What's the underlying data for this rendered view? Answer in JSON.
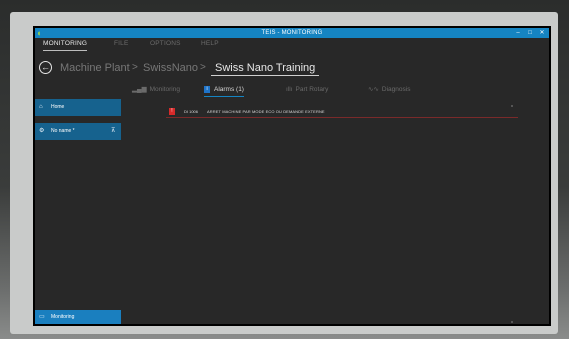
{
  "window": {
    "title": "TEIS - MONITORING",
    "minimize_label": "–",
    "maximize_label": "□",
    "close_label": "✕"
  },
  "menu": [
    "MONITORING",
    "FILE",
    "OPTIONS",
    "HELP"
  ],
  "breadcrumb": {
    "items": [
      "Machine Plant",
      "SwissNano"
    ],
    "current": "Swiss Nano Training",
    "separator": ">"
  },
  "tabs": [
    {
      "label": "Monitoring",
      "icon": "bar-chart-icon"
    },
    {
      "label": "Alarms (1)",
      "icon": "info-badge-icon",
      "badge": "i",
      "active": true
    },
    {
      "label": "Part Rotary",
      "icon": "bars-icon"
    },
    {
      "label": "Diagnosis",
      "icon": "waveform-icon"
    }
  ],
  "sidebar": {
    "home": {
      "label": "Home",
      "icon": "home-icon"
    },
    "machine": {
      "label": "No name *",
      "icon": "machine-icon",
      "pin": "pin-icon"
    },
    "monitoring": {
      "label": "Monitoring",
      "icon": "monitor-icon"
    }
  },
  "alarm": {
    "badge": "!",
    "code": "DI 1006",
    "message": "ARRET MACHINE PAR MODE ECO OU DEMANDE EXTERNE"
  },
  "colors": {
    "accent": "#1584c2",
    "sidebar": "#16628e",
    "alarm": "#d72a2a",
    "background": "#282828"
  }
}
